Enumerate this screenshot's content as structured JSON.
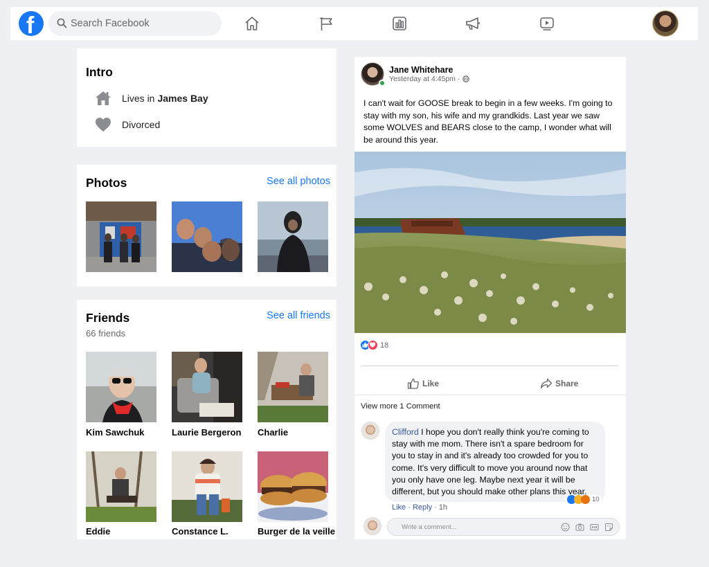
{
  "header": {
    "logo_letter": "f",
    "search_placeholder": "Search Facebook",
    "nav_icons": [
      "home-icon",
      "flag-icon",
      "chart-icon",
      "megaphone-icon",
      "watch-icon"
    ]
  },
  "intro": {
    "title": "Intro",
    "lives_prefix": "Lives in",
    "lives_place": "James Bay",
    "status": "Divorced"
  },
  "photos": {
    "title": "Photos",
    "see_all": "See all photos"
  },
  "friends": {
    "title": "Friends",
    "count": "66 friends",
    "see_all": "See all friends",
    "items": [
      {
        "name": "Kim Sawchuk"
      },
      {
        "name": "Laurie Bergeron"
      },
      {
        "name": "Charlie"
      },
      {
        "name": "Eddie"
      },
      {
        "name": "Constance L."
      },
      {
        "name": "Burger de la veille"
      }
    ]
  },
  "post": {
    "author": "Jane Whitehare",
    "time": "Yesterday at 4:45pm ·",
    "text": "I can't wait for GOOSE break to begin in a few weeks. I'm going to stay with my son, his wife and my grandkids. Last year we saw some WOLVES and BEARS close to the camp, I wonder what will be around this year.",
    "reaction_count": "18",
    "like_label": "Like",
    "share_label": "Share",
    "view_more": "View more 1 Comment",
    "comment": {
      "author": "Clifford",
      "text": "I hope you don't really think you're coming to stay with me mom. There isn't a spare bedroom for you to stay in and it's already too crowded for you to come. It's very difficult to move you around now that you only have one leg. Maybe next year it will be different, but you should make other plans this year.",
      "reaction_count": "10",
      "like": "Like",
      "sep": " · ",
      "reply": "Reply",
      "time": "· 1h"
    },
    "write_placeholder": "Write a comment..."
  },
  "colors": {
    "brand": "#1877f2",
    "background": "#eef0f3",
    "link": "#385898"
  }
}
